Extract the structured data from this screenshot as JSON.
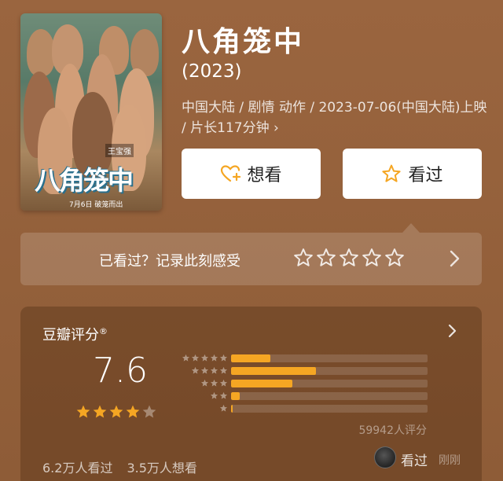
{
  "movie": {
    "title": "八角笼中",
    "year": "(2023)",
    "meta": "中国大陆 / 剧情 动作 / 2023-07-06(中国大陆)上映 / 片长117分钟 ›",
    "poster": {
      "title_art": "八角笼中",
      "date_line": "7月6日 破笼而出",
      "star_tag": "王宝强"
    }
  },
  "actions": {
    "want_label": "想看",
    "want_icon": "heart-plus-icon",
    "seen_label": "看过",
    "seen_icon": "star-outline-icon",
    "accent_color": "#f5a623"
  },
  "record": {
    "prompt": "已看过？记录此刻感受",
    "star_slots": 5,
    "arrow_icon": "chevron-right-icon"
  },
  "rating": {
    "label": "豆瓣评分",
    "label_mark": "®",
    "score": "7.6",
    "stars_filled": 4,
    "stars_total": 5,
    "distribution": [
      {
        "stars": 5,
        "fraction": 0.2
      },
      {
        "stars": 4,
        "fraction": 0.43
      },
      {
        "stars": 3,
        "fraction": 0.31
      },
      {
        "stars": 2,
        "fraction": 0.045
      },
      {
        "stars": 1,
        "fraction": 0.008
      }
    ],
    "count_text": "59942人评分",
    "seen_count": "6.2万人看过",
    "want_count": "3.5万人想看",
    "recent": {
      "label": "看过",
      "time": "刚刚"
    }
  }
}
